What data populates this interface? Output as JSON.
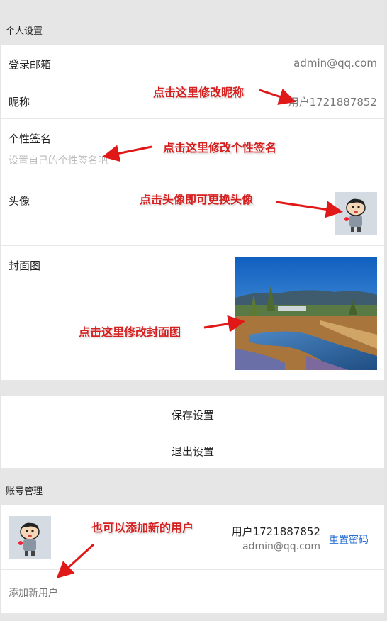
{
  "personal_section": {
    "title": "个人设置"
  },
  "rows": {
    "email": {
      "label": "登录邮箱",
      "value": "admin@qq.com"
    },
    "nickname": {
      "label": "昵称",
      "value": "用户1721887852"
    },
    "signature": {
      "label": "个性签名",
      "placeholder": "设置自己的个性签名吧"
    },
    "avatar": {
      "label": "头像"
    },
    "cover": {
      "label": "封面图"
    }
  },
  "actions": {
    "save": "保存设置",
    "logout": "退出设置"
  },
  "account_section": {
    "title": "账号管理"
  },
  "account": {
    "username": "用户1721887852",
    "email": "admin@qq.com",
    "reset_link": "重置密码",
    "add_user": "添加新用户"
  },
  "annotations": {
    "nickname": "点击这里修改昵称",
    "signature": "点击这里修改个性签名",
    "avatar": "点击头像即可更换头像",
    "cover": "点击这里修改封面图",
    "add_user": "也可以添加新的用户"
  },
  "colors": {
    "annotation": "#d61f1f",
    "link": "#2a6fd6",
    "background": "#e6e6e6"
  }
}
